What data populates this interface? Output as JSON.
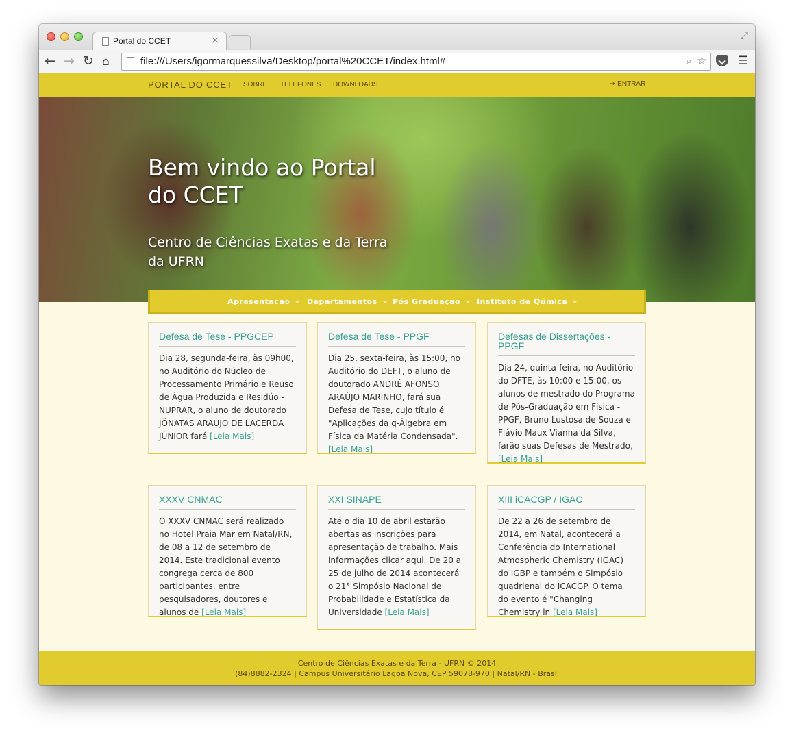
{
  "browser": {
    "tab_title": "Portal do CCET",
    "tab_close": "×",
    "url": "file:///Users/igormarquessilva/Desktop/portal%20CCET/index.html#",
    "icons": {
      "back": "back-arrow-icon",
      "forward": "forward-arrow-icon",
      "reload": "reload-icon",
      "home": "home-icon",
      "search": "magnifier-icon",
      "bookmark": "star-icon",
      "pocket": "pocket-icon",
      "menu": "hamburger-menu-icon"
    }
  },
  "topnav": {
    "brand": "PORTAL DO CCET",
    "links": [
      "SOBRE",
      "TELEFONES",
      "DOWNLOADS"
    ],
    "login": "ENTRAR"
  },
  "hero": {
    "title": "Bem vindo ao Portal do CCET",
    "subtitle": "Centro de Ciências Exatas e da Terra da UFRN"
  },
  "subnav": {
    "items": [
      "Apresentação",
      "Departamentos",
      "Pós Graduação",
      "Instituto de Qúmica"
    ]
  },
  "cards": [
    {
      "title": "Defesa de Tese - PPGCEP",
      "text": "Dia 28, segunda-feira, às 09h00, no Auditório do Núcleo de Processamento Primário e Reuso de Água Produzida e Residúo - NUPRAR, o aluno de doutorado JÔNATAS ARAÚJO DE LACERDA JÚNIOR fará",
      "more": "[Leia Mais]"
    },
    {
      "title": "Defesa de Tese - PPGF",
      "text": "Dia 25, sexta-feira, às 15:00, no Auditório do DEFT, o aluno de doutorado ANDRÉ AFONSO ARAÚJO MARINHO, fará sua Defesa de Tese, cujo título é \"Aplicações da q-Álgebra em Física da Matéria Condensada\".",
      "more": "[Leia Mais]"
    },
    {
      "title": "Defesas de Dissertações - PPGF",
      "text": "Dia 24, quinta-feira, no Auditório do DFTE, às 10:00 e 15:00, os alunos de mestrado do Programa de Pós-Graduação em Física - PPGF, Bruno Lustosa de Souza e Flávio Maux Vianna da Silva, farão suas Defesas de Mestrado,",
      "more": "[Leia Mais]"
    },
    {
      "title": "XXXV CNMAC",
      "text": "O XXXV CNMAC será realizado no Hotel Praia Mar em Natal/RN, de 08 a 12 de setembro de 2014. Este tradicional evento congrega cerca de 800 participantes, entre pesquisadores, doutores e alunos de",
      "more": "[Leia Mais]"
    },
    {
      "title": "XXI SINAPE",
      "text": "Até o dia 10 de abril estarão abertas as inscrições para apresentação de trabalho. Mais informações clicar aqui. De 20 a 25 de julho de 2014 acontecerá o 21° Simpósio Nacional de Probabilidade e Estatística da Universidade",
      "more": "[Leia Mais]"
    },
    {
      "title": "XIII iCACGP / IGAC",
      "text": "De 22 a 26 de setembro de 2014, em Natal, acontecerá a Conferência do International Atmospheric Chemistry (IGAC) do IGBP e também o Simpósio quadrienal do ICACGP. O tema do evento é \"Changing Chemistry in",
      "more": "[Leia Mais]"
    }
  ],
  "footer": {
    "line1": "Centro de Ciências Exatas e da Terra - UFRN © 2014",
    "line2": "(84)8882-2324 | Campus Universitário Lagoa Nova, CEP 59078-970 | Natal/RN - Brasil"
  }
}
